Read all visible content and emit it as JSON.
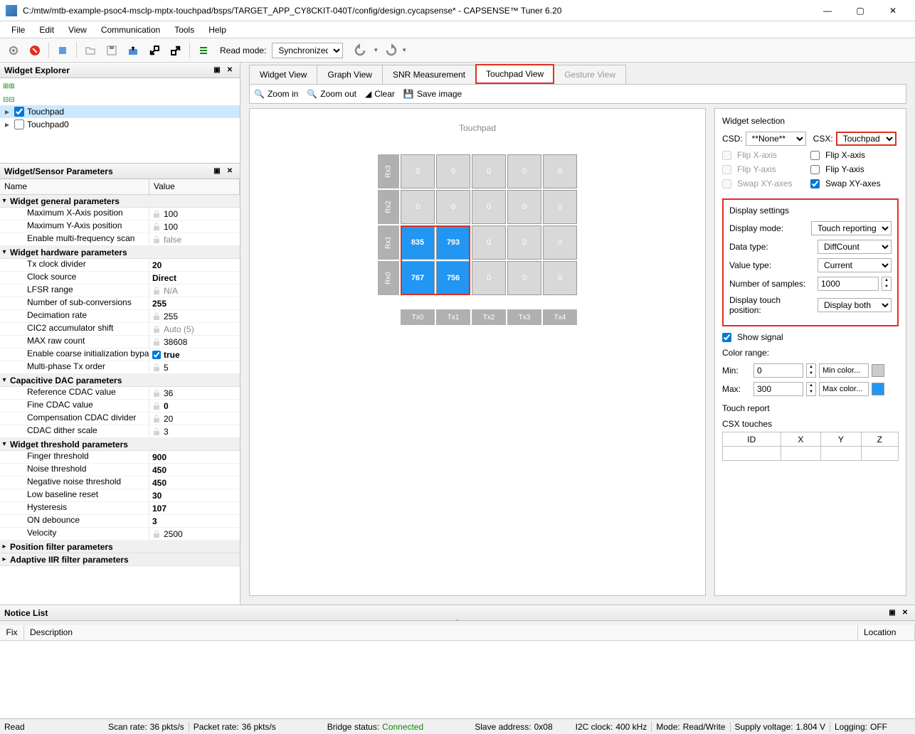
{
  "title": "C:/mtw/mtb-example-psoc4-msclp-mptx-touchpad/bsps/TARGET_APP_CY8CKIT-040T/config/design.cycapsense* - CAPSENSE™ Tuner 6.20",
  "menu": [
    "File",
    "Edit",
    "View",
    "Communication",
    "Tools",
    "Help"
  ],
  "toolbar": {
    "read_mode_label": "Read mode:",
    "read_mode_value": "Synchronized"
  },
  "widget_explorer": {
    "title": "Widget Explorer",
    "items": [
      {
        "label": "Touchpad",
        "checked": true,
        "selected": true
      },
      {
        "label": "Touchpad0",
        "checked": false,
        "selected": false
      }
    ]
  },
  "params_panel": {
    "title": "Widget/Sensor Parameters",
    "col_name": "Name",
    "col_value": "Value",
    "groups": [
      {
        "name": "Widget general parameters",
        "rows": [
          {
            "n": "Maximum X-Axis position",
            "v": "100",
            "lock": true
          },
          {
            "n": "Maximum Y-Axis position",
            "v": "100",
            "lock": true
          },
          {
            "n": "Enable multi-frequency scan",
            "v": "false",
            "lock": true,
            "grey": true
          }
        ]
      },
      {
        "name": "Widget hardware parameters",
        "rows": [
          {
            "n": "Tx clock divider",
            "v": "20",
            "bold": true
          },
          {
            "n": "Clock source",
            "v": "Direct",
            "bold": true
          },
          {
            "n": "LFSR range",
            "v": "N/A",
            "lock": true,
            "grey": true
          },
          {
            "n": "Number of sub-conversions",
            "v": "255",
            "bold": true
          },
          {
            "n": "Decimation rate",
            "v": "255",
            "lock": true
          },
          {
            "n": "CIC2 accumulator shift",
            "v": "Auto (5)",
            "lock": true,
            "grey": true
          },
          {
            "n": "MAX raw count",
            "v": "38608",
            "lock": true
          },
          {
            "n": "Enable coarse initialization bypass",
            "v": "true",
            "bold": true,
            "check": true
          },
          {
            "n": "Multi-phase Tx order",
            "v": "5",
            "lock": true
          }
        ]
      },
      {
        "name": "Capacitive DAC parameters",
        "rows": [
          {
            "n": "Reference CDAC value",
            "v": "36",
            "lock": true
          },
          {
            "n": "Fine CDAC value",
            "v": "0",
            "lock": true,
            "bold": true
          },
          {
            "n": "Compensation CDAC divider",
            "v": "20",
            "lock": true
          },
          {
            "n": "CDAC dither scale",
            "v": "3",
            "lock": true
          }
        ]
      },
      {
        "name": "Widget threshold parameters",
        "rows": [
          {
            "n": "Finger threshold",
            "v": "900",
            "bold": true
          },
          {
            "n": "Noise threshold",
            "v": "450",
            "bold": true
          },
          {
            "n": "Negative noise threshold",
            "v": "450",
            "bold": true
          },
          {
            "n": "Low baseline reset",
            "v": "30",
            "bold": true
          },
          {
            "n": "Hysteresis",
            "v": "107",
            "bold": true
          },
          {
            "n": "ON debounce",
            "v": "3",
            "bold": true
          },
          {
            "n": "Velocity",
            "v": "2500",
            "lock": true
          }
        ]
      },
      {
        "name": "Position filter parameters",
        "collapsed": true,
        "rows": []
      },
      {
        "name": "Adaptive IIR filter parameters",
        "collapsed": true,
        "rows": []
      }
    ]
  },
  "tabs": [
    {
      "label": "Widget View"
    },
    {
      "label": "Graph View"
    },
    {
      "label": "SNR Measurement"
    },
    {
      "label": "Touchpad View",
      "active": true,
      "highlighted": true
    },
    {
      "label": "Gesture View",
      "disabled": true
    }
  ],
  "tp_actions": {
    "zoom_in": "Zoom in",
    "zoom_out": "Zoom out",
    "clear": "Clear",
    "save": "Save image"
  },
  "touchpad": {
    "title": "Touchpad",
    "rows": [
      "Rx3",
      "Rx2",
      "Rx1",
      "Rx0"
    ],
    "cols": [
      "Tx0",
      "Tx1",
      "Tx2",
      "Tx3",
      "Tx4"
    ],
    "cells": [
      [
        "0",
        "0",
        "0",
        "0",
        "0"
      ],
      [
        "0",
        "0",
        "0",
        "0",
        "0"
      ],
      [
        "835",
        "793",
        "0",
        "0",
        "0"
      ],
      [
        "767",
        "756",
        "0",
        "0",
        "0"
      ]
    ],
    "active_cells": [
      [
        2,
        0
      ],
      [
        2,
        1
      ],
      [
        3,
        0
      ],
      [
        3,
        1
      ]
    ]
  },
  "settings": {
    "widget_selection": "Widget selection",
    "csd_label": "CSD:",
    "csd_value": "**None**",
    "csx_label": "CSX:",
    "csx_value": "Touchpad",
    "csd_flip_x": "Flip X-axis",
    "csd_flip_y": "Flip Y-axis",
    "csd_swap": "Swap XY-axes",
    "csx_flip_x": "Flip X-axis",
    "csx_flip_y": "Flip Y-axis",
    "csx_swap": "Swap XY-axes",
    "display_settings": "Display settings",
    "display_mode_label": "Display mode:",
    "display_mode_value": "Touch reporting",
    "data_type_label": "Data type:",
    "data_type_value": "DiffCount",
    "value_type_label": "Value type:",
    "value_type_value": "Current",
    "num_samples_label": "Number of samples:",
    "num_samples_value": "1000",
    "touch_pos_label": "Display touch position:",
    "touch_pos_value": "Display both",
    "show_signal": "Show signal",
    "color_range": "Color range:",
    "min_label": "Min:",
    "min_value": "0",
    "min_color_btn": "Min color...",
    "max_label": "Max:",
    "max_value": "300",
    "max_color_btn": "Max color...",
    "touch_report": "Touch report",
    "csx_touches": "CSX touches",
    "table_headers": [
      "ID",
      "X",
      "Y",
      "Z"
    ]
  },
  "notice": {
    "title": "Notice List",
    "col_fix": "Fix",
    "col_desc": "Description",
    "col_loc": "Location"
  },
  "status": {
    "read": "Read",
    "scan_rate_l": "Scan rate:",
    "scan_rate_v": "36 pkts/s",
    "packet_rate_l": "Packet rate:",
    "packet_rate_v": "36 pkts/s",
    "bridge_l": "Bridge status:",
    "bridge_v": "Connected",
    "slave_l": "Slave address:",
    "slave_v": "0x08",
    "i2c_l": "I2C clock:",
    "i2c_v": "400 kHz",
    "mode_l": "Mode:",
    "mode_v": "Read/Write",
    "supply_l": "Supply voltage:",
    "supply_v": "1.804 V",
    "log_l": "Logging:",
    "log_v": "OFF"
  }
}
